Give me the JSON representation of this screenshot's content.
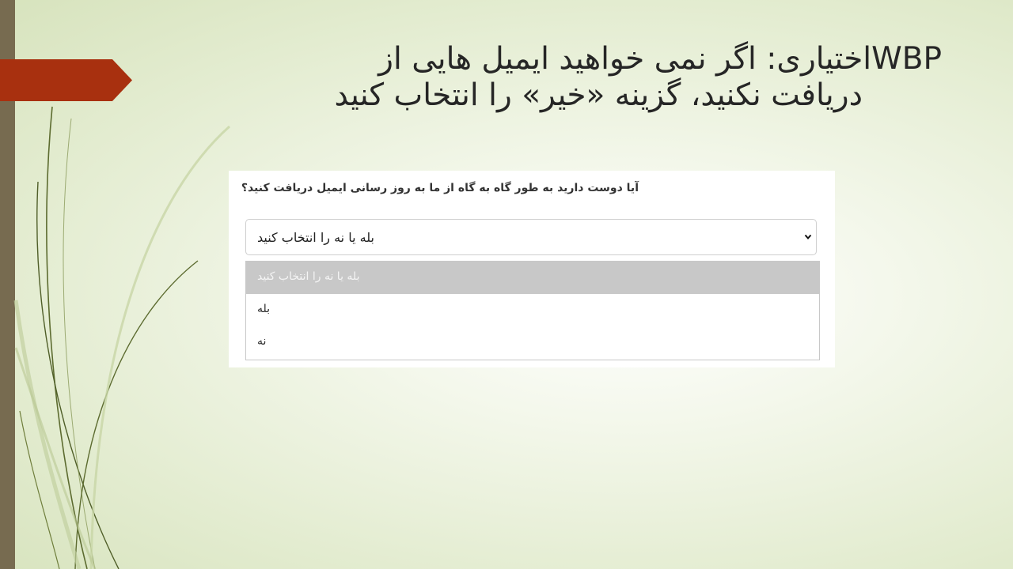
{
  "slide": {
    "title_line1": "WBPاختیاری: اگر نمی خواهید ایمیل هایی از",
    "title_line2": "دریافت نکنید، گزینه «خیر» را انتخاب کنید"
  },
  "form": {
    "question": "آیا دوست دارید به طور گاه به گاه از ما به روز رسانی ایمیل دریافت کنید؟",
    "select_value": "بله یا نه را انتخاب کنید",
    "options": [
      {
        "label": "بله یا نه را انتخاب کنید",
        "highlighted": true
      },
      {
        "label": "بله",
        "highlighted": false
      },
      {
        "label": "نه",
        "highlighted": false
      }
    ]
  },
  "colors": {
    "accent": "#a8300f",
    "left_bar": "#776b50",
    "option_highlight": "#c8c8c8"
  },
  "icons": {
    "select": "chevron-down-icon"
  }
}
